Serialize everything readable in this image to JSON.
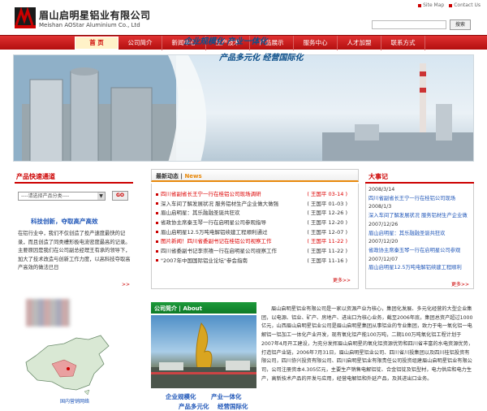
{
  "header": {
    "company_cn": "眉山启明星铝业有限公司",
    "company_en": "Meishan AOStar Aluminium Co., Ltd",
    "top_links": [
      "Site Map",
      "Contact Us"
    ],
    "search_button": "搜索"
  },
  "nav": {
    "items": [
      "首 页",
      "公司简介",
      "新闻中心",
      "生产技术",
      "产品展示",
      "服务中心",
      "人才加盟",
      "联系方式"
    ],
    "active_index": 0
  },
  "banner": {
    "line1": "企业规模化 产业一体化",
    "line2": "产品多元化 经营国际化"
  },
  "quick": {
    "title": "产品快速通道",
    "select_placeholder": "----请选择产品分类----",
    "go_label": "GO"
  },
  "left_intro": {
    "slogan": "科技创新，夺取高产高效",
    "text": "在铝行业中，我们不仅创造了投产速度最快的记录，而且创造了同类槽形极电流密度最高的记录。主要原因是我们在公司副总经理王有承的领导下，加大了技术改造与创新工作力度，以高科技夺取高产高效的做法已日",
    "more": ">>"
  },
  "map": {
    "label": "国内营销网络"
  },
  "news": {
    "title": "最新动态",
    "title_en": "News",
    "items": [
      {
        "text": "四川省副省长王宁一行在桂铝公司现场调研",
        "date": "( 王国平 03-14 )",
        "highlight": true
      },
      {
        "text": "深入车间了解发展状况 服务铝材生产企业做大做强",
        "date": "( 王国平 01-03 )",
        "highlight": false
      },
      {
        "text": "眉山启明星：其乐融融圣诞共狂欢",
        "date": "( 王国平 12-26 )",
        "highlight": false
      },
      {
        "text": "省政协主席秦玉琴一行在启明星公司参观指导",
        "date": "( 王国平 12-20 )",
        "highlight": false
      },
      {
        "text": "眉山启明星12.5万吨电解铝续建工程顺利通过",
        "date": "( 王国平 12-07 )",
        "highlight": false
      },
      {
        "text": "图片新闻！四川省委副书记在桂铝公司视察工作",
        "date": "( 王国平 11-22 )",
        "highlight": true
      },
      {
        "text": "四川省委副书记李崇禧一行在启明星公司视察工作",
        "date": "( 王国平 11-22 )",
        "highlight": false
      },
      {
        "text": "\"2007年中国国际铝业论坛\"参会指南",
        "date": "( 王国平 11-16 )",
        "highlight": false
      }
    ],
    "more": "更多>>"
  },
  "events": {
    "title": "大事记",
    "items": [
      {
        "date": "2008/3/14",
        "text": "四川省副省长王宁一行在桂铝公司现场"
      },
      {
        "date": "2008/1/3",
        "text": "深入车间了解发展状况 服务铝材生产企业做"
      },
      {
        "date": "2007/12/26",
        "text": "眉山启明星：其乐融融圣诞共狂欢"
      },
      {
        "date": "2007/12/20",
        "text": "省政协主席秦玉琴一行在启明星公司参观"
      },
      {
        "date": "2007/12/07",
        "text": "眉山启明星12.5万吨电解铝续建工程顺利"
      }
    ],
    "more": "更多>>"
  },
  "company": {
    "title": "公司简介",
    "title_en": "About",
    "slogans": [
      "企业规模化",
      "产业一体化",
      "产品多元化",
      "经营国际化"
    ],
    "text": "眉山启明星铝业有限公司是一家以资源产业为核心，集团化发展、多元化经营的大型企业集团，以电源、铝业、矿产、房地产、进出口为核心业务，截至2006年底，集团总资产超过1000亿元，山西眉山启明星铝业公司是眉山启明星集团从事铝业的专业集团，致力于电一氧化铝一电解铝一铝加工一体化产业开发，现有氧化铝产能100万吨，二期100万吨氧化铝工程计划于2007年4月开工建设，为充分发挥眉山启明星的氧化铝资源优势和四川省丰富的水电资源优势，打造铝产业链，2006年7月31日，眉山启明星铝业公司、四川省川投集团以及四川桂铝投资有限公司，四川协兴投资有限公司、四川启明星铝业有限责任公司投资组建眉山启明星铝业有限公司，公司注册资本4.305亿元，主要生产销售电解铝锭、合金铝锭及铝型材，电力供应和电力生产，高新技术产品的开发与应用，经营电解铝和外延产品，及其进出口业务。"
  }
}
